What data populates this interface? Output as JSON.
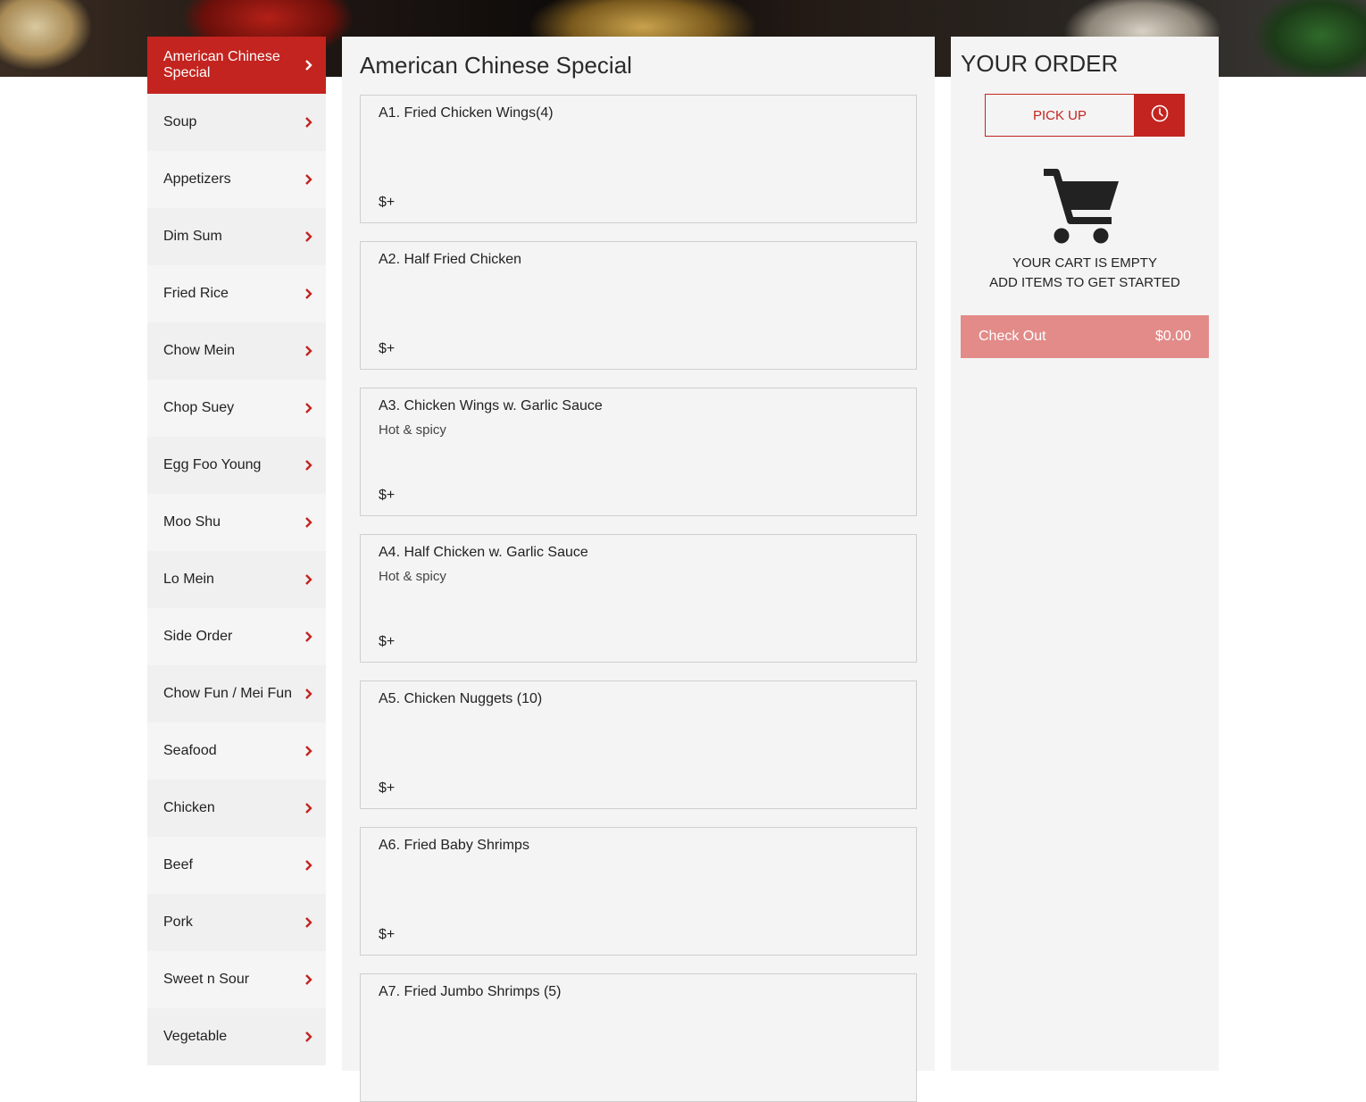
{
  "colors": {
    "accent": "#c3241f",
    "checkout_bg": "#e28b89",
    "panel_bg": "#f4f4f4"
  },
  "sidebar": {
    "items": [
      {
        "label": "American Chinese Special",
        "active": true
      },
      {
        "label": "Soup"
      },
      {
        "label": "Appetizers"
      },
      {
        "label": "Dim Sum"
      },
      {
        "label": "Fried Rice"
      },
      {
        "label": "Chow Mein"
      },
      {
        "label": "Chop Suey"
      },
      {
        "label": "Egg Foo Young"
      },
      {
        "label": "Moo Shu"
      },
      {
        "label": "Lo Mein"
      },
      {
        "label": "Side Order"
      },
      {
        "label": "Chow Fun / Mei Fun"
      },
      {
        "label": "Seafood"
      },
      {
        "label": "Chicken"
      },
      {
        "label": "Beef"
      },
      {
        "label": "Pork"
      },
      {
        "label": "Sweet n Sour"
      },
      {
        "label": "Vegetable"
      }
    ]
  },
  "menu": {
    "title": "American Chinese Special",
    "items": [
      {
        "name": "A1. Fried Chicken Wings(4)",
        "description": "",
        "price": "$+"
      },
      {
        "name": "A2. Half Fried Chicken",
        "description": "",
        "price": "$+"
      },
      {
        "name": "A3. Chicken Wings w. Garlic Sauce",
        "description": "Hot & spicy",
        "price": "$+"
      },
      {
        "name": "A4. Half Chicken w. Garlic Sauce",
        "description": "Hot & spicy",
        "price": "$+"
      },
      {
        "name": "A5. Chicken Nuggets (10)",
        "description": "",
        "price": "$+"
      },
      {
        "name": "A6. Fried Baby Shrimps",
        "description": "",
        "price": "$+"
      },
      {
        "name": "A7. Fried Jumbo Shrimps (5)",
        "description": "",
        "price": ""
      }
    ]
  },
  "order": {
    "title": "YOUR ORDER",
    "pickup_label": "PICK UP",
    "clock_icon": "clock-icon",
    "cart_icon": "cart-icon",
    "empty_line1": "YOUR CART IS EMPTY",
    "empty_line2": "ADD ITEMS TO GET STARTED",
    "checkout_label": "Check Out",
    "checkout_total": "$0.00"
  }
}
